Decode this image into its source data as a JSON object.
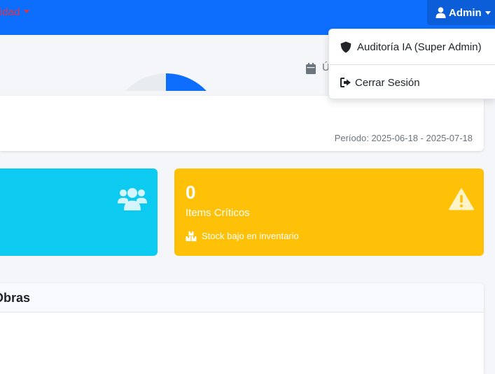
{
  "navbar": {
    "partial_menu_label": "idad",
    "admin_label": "Admin"
  },
  "header": {
    "date_partial": "Ú"
  },
  "period_card": {
    "periodo": "Período: 2025-06-18 - 2025-07-18"
  },
  "critical_card": {
    "value": "0",
    "label": "Items Críticos",
    "footer": "Stock bajo en inventario"
  },
  "chart_card": {
    "title_partial": "Obras"
  },
  "user_menu": {
    "items": [
      {
        "label": "Auditoría IA (Super Admin)",
        "icon": "shield-icon"
      },
      {
        "label": "Cerrar Sesión",
        "icon": "sign-out-icon"
      }
    ]
  },
  "colors": {
    "navbar": "#0d6efd",
    "critical_text": "#dc3545",
    "info_card": "#0dcaf0",
    "warning_card": "#ffc107",
    "donut_primary": "#0d6efd",
    "donut_track": "#e9ecef"
  }
}
